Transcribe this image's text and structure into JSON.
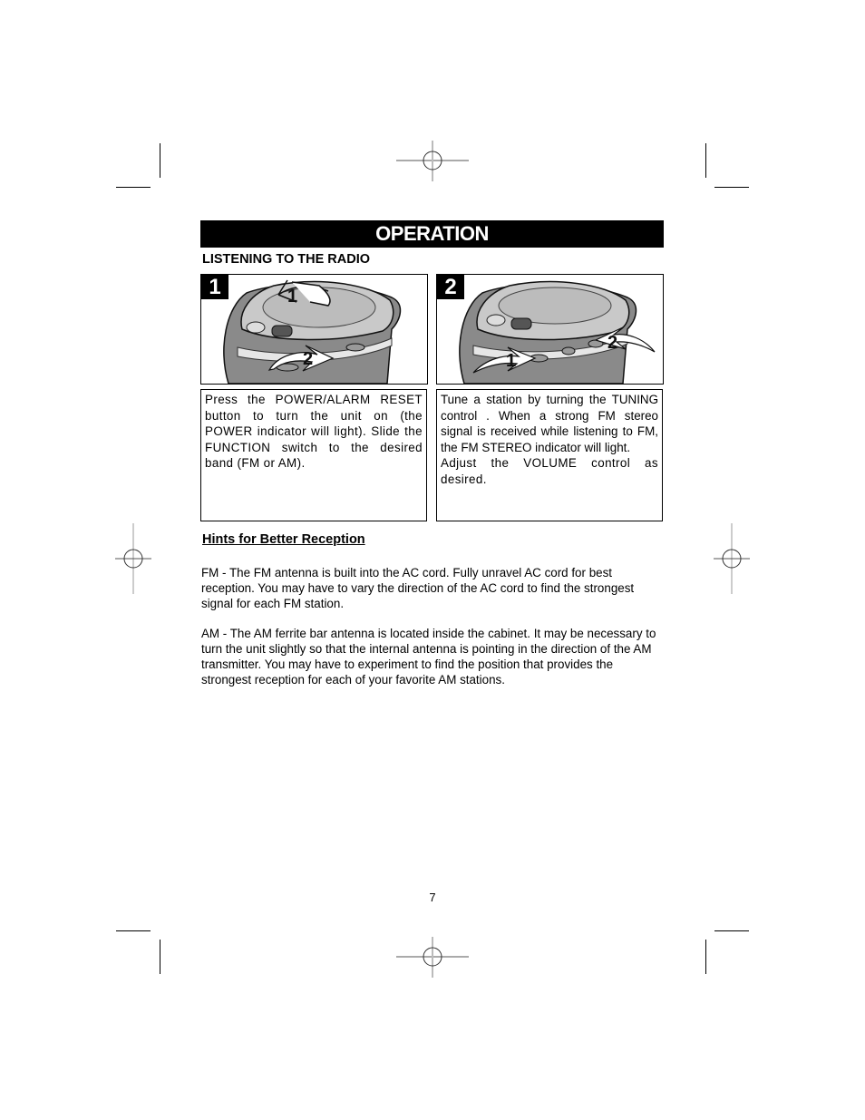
{
  "header": {
    "title": "OPERATION"
  },
  "section": {
    "heading": "LISTENING TO THE RADIO"
  },
  "steps": [
    {
      "number": "1",
      "callouts": [
        "1",
        "2"
      ],
      "text": "Press the POWER/ALARM RESET button    to turn the unit on (the POWER indicator will light). Slide the FUNCTION switch    to the desired band (FM or AM)."
    },
    {
      "number": "2",
      "callouts": [
        "1",
        "2"
      ],
      "text_line1": "Tune a station by turning the TUNING control   . When a strong FM stereo signal is received while listening to FM, the FM STEREO indicator will light.",
      "text_line2": "Adjust the VOLUME control    as desired."
    }
  ],
  "hints": {
    "heading": "Hints for Better Reception",
    "fm": "FM - The FM antenna is built into the AC cord. Fully unravel AC cord for best reception. You may have to vary the direction of the AC cord to find the strongest signal for each FM station.",
    "am": "AM - The AM ferrite bar antenna is located inside the cabinet. It may be necessary to turn the unit slightly so that the internal antenna is pointing in the direction of the AM transmitter. You may have to experiment to find the position that provides the strongest reception for each of your favorite AM stations."
  },
  "footer": {
    "page_number": "7"
  }
}
